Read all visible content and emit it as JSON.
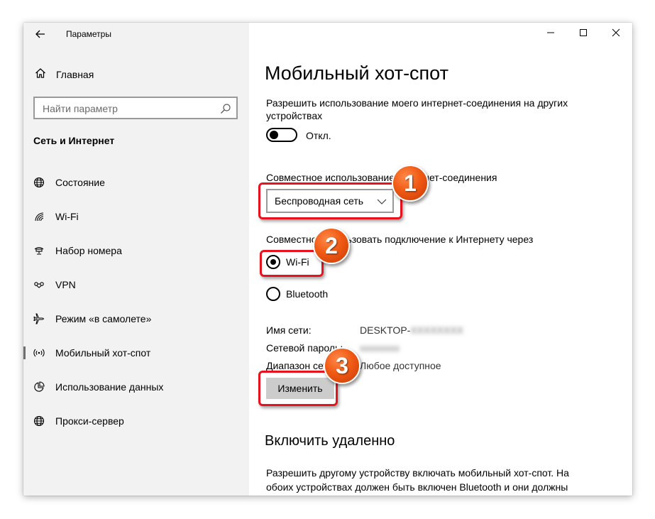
{
  "window": {
    "title": "Параметры"
  },
  "sidebar": {
    "home_label": "Главная",
    "search_placeholder": "Найти параметр",
    "section_title": "Сеть и Интернет",
    "items": [
      {
        "label": "Состояние",
        "icon": "globe-icon",
        "selected": false
      },
      {
        "label": "Wi-Fi",
        "icon": "wifi-icon",
        "selected": false
      },
      {
        "label": "Набор номера",
        "icon": "dialup-icon",
        "selected": false
      },
      {
        "label": "VPN",
        "icon": "vpn-icon",
        "selected": false
      },
      {
        "label": "Режим «в самолете»",
        "icon": "airplane-icon",
        "selected": false
      },
      {
        "label": "Мобильный хот-спот",
        "icon": "hotspot-icon",
        "selected": true
      },
      {
        "label": "Использование данных",
        "icon": "data-usage-icon",
        "selected": false
      },
      {
        "label": "Прокси-сервер",
        "icon": "globe-icon",
        "selected": false
      }
    ]
  },
  "main": {
    "title": "Мобильный хот-спот",
    "share_desc": "Разрешить использование моего интернет-соединения на других устройствах",
    "toggle_state": "Откл.",
    "share_from_label": "Совместное использование интернет-соединения",
    "share_from_value": "Беспроводная сеть",
    "share_over_label": "Совместно использовать подключение к Интернету через",
    "radio_wifi": "Wi-Fi",
    "radio_bluetooth": "Bluetooth",
    "network_name_label": "Имя сети:",
    "network_name_value": "DESKTOP-",
    "network_password_label": "Сетевой пароль:",
    "network_band_label": "Диапазон сети:",
    "network_band_value": "Любое доступное",
    "change_button": "Изменить",
    "remote_title": "Включить удаленно",
    "remote_desc": "Разрешить другому устройству включать мобильный хот-спот. На обоих устройствах должен быть включен Bluetooth и они должны быть"
  },
  "annotations": {
    "badge1": "1",
    "badge2": "2",
    "badge3": "3"
  },
  "colors": {
    "highlight": "#e8121f",
    "badge": "#f05a14",
    "sidebar_bg": "#f2f2f2",
    "button_bg": "#cccccc"
  }
}
